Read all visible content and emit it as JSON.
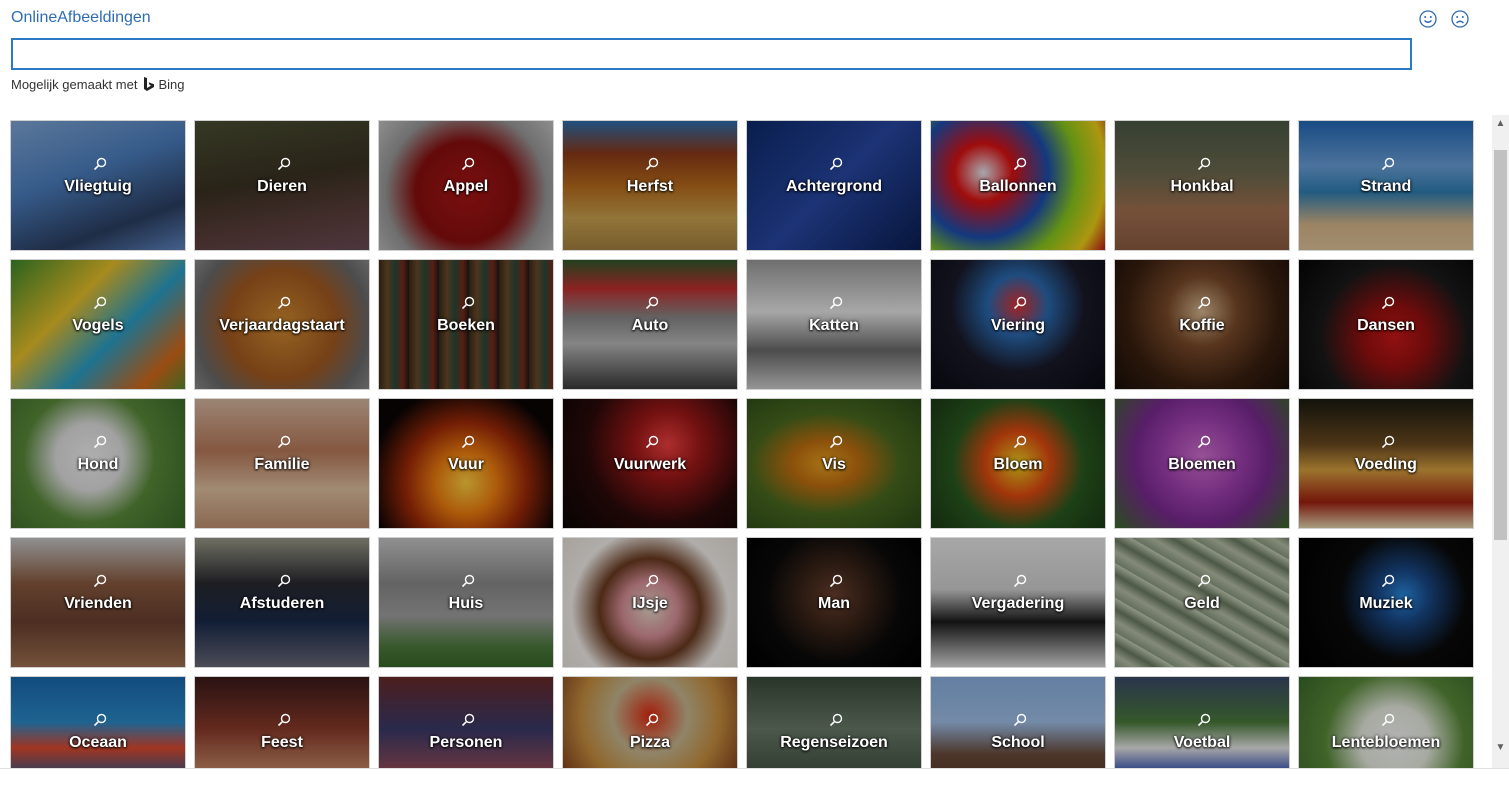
{
  "dialog": {
    "title": "OnlineAfbeeldingen",
    "search": {
      "value": "",
      "placeholder": ""
    },
    "powered_by": "Mogelijk gemaakt met",
    "bing_label": "Bing",
    "feedback": {
      "smile_icon": "smile-icon",
      "frown_icon": "frown-icon"
    }
  },
  "colors": {
    "accent": "#2b78c5",
    "title": "#2e6db4"
  },
  "categories": [
    {
      "label": "Vliegtuig",
      "bg": "linear-gradient(160deg,#7fa6d6 0%,#4c7fc0 40%,#2b3f62 75%,#5d86c2 100%)"
    },
    {
      "label": "Dieren",
      "bg": "linear-gradient(170deg,#4a4f33 0%,#3a3222 45%,#5c3f3c 75%,#6b4d57 100%)"
    },
    {
      "label": "Appel",
      "bg": "radial-gradient(circle at 50% 55%,#a91515 0%,#8a0f0f 45%,#9a9a9a 72%,#c4c4c4 100%)"
    },
    {
      "label": "Herfst",
      "bg": "linear-gradient(180deg,#2d6fb0 0%,#8b3a1a 25%,#b86b1b 50%,#c9a24f 75%,#a68240 100%)"
    },
    {
      "label": "Achtergrond",
      "bg": "linear-gradient(135deg,#0d2a6b 0%,#2747a3 50%,#0b1f54 100%)"
    },
    {
      "label": "Ballonnen",
      "bg": "radial-gradient(circle at 30% 40%,#e8e8f0 0%,#d11 20%,#1c4fb0 45%,#8acb1c 65%,#f0d018 85%,#c01818 100%)"
    },
    {
      "label": "Honkbal",
      "bg": "linear-gradient(180deg,#4b5a45 0%,#6d6a50 40%,#a37050 70%,#8a5c40 100%)"
    },
    {
      "label": "Strand",
      "bg": "linear-gradient(180deg,#2469b8 0%,#6aa0d8 35%,#2f7fb3 55%,#d7b78a 80%,#e0c49c 100%)"
    },
    {
      "label": "Vogels",
      "bg": "linear-gradient(135deg,#3c8a2a 0%,#e8c02a 35%,#2aa0c8 60%,#d66a1a 85%,#5a8a30 100%)"
    },
    {
      "label": "Verjaardagstaart",
      "bg": "radial-gradient(circle at 50% 50%,#d08a30 0%,#a45a20 50%,#6a6a6a 80%,#8a8a8a 100%)"
    },
    {
      "label": "Boeken",
      "bg": "repeating-linear-gradient(90deg,#3a2a1a 0px,#6a4a2a 8px,#2a4a3a 16px,#7a2a1a 24px,#1a1a1a 30px)"
    },
    {
      "label": "Auto",
      "bg": "linear-gradient(180deg,#2e5a2a 0%,#c23030 22%,#8a8a8a 45%,#b8b8b8 65%,#3a3a3a 100%)"
    },
    {
      "label": "Katten",
      "bg": "linear-gradient(180deg,#9a9a9a 0%,#e8e8e8 40%,#6a6a6a 70%,#cfcfcf 100%)"
    },
    {
      "label": "Viering",
      "bg": "radial-gradient(circle at 50% 35%,#e03030 0%,#2a6ab0 25%,#1a1a2a 55%,#0a0a14 100%)"
    },
    {
      "label": "Koffie",
      "bg": "radial-gradient(circle at 50% 40%,#d8b890 0%,#7a4a2a 30%,#3a2010 65%,#1a0e08 100%)"
    },
    {
      "label": "Dansen",
      "bg": "radial-gradient(circle at 55% 60%,#c81818 0%,#9a1010 25%,#1a1a1a 60%,#050505 100%)"
    },
    {
      "label": "Hond",
      "bg": "radial-gradient(circle at 45% 45%,#f2f2f2 0%,#e0e0e0 28%,#5a8a3a 55%,#3a6a2a 100%)"
    },
    {
      "label": "Familie",
      "bg": "linear-gradient(180deg,#d8b8a0 0%,#b87a5a 40%,#e0c0a0 70%,#c09070 100%)"
    },
    {
      "label": "Vuur",
      "bg": "radial-gradient(circle at 50% 65%,#ffd040 0%,#f08010 25%,#a02a08 50%,#0a0505 80%)"
    },
    {
      "label": "Vuurwerk",
      "bg": "radial-gradient(circle at 60% 35%,#f04040 0%,#a01818 25%,#2a0a0a 60%,#0a0505 100%)"
    },
    {
      "label": "Vis",
      "bg": "radial-gradient(ellipse at 45% 50%,#e8a020 0%,#c07010 25%,#4a6a20 55%,#2a4a18 100%)"
    },
    {
      "label": "Bloem",
      "bg": "radial-gradient(circle at 50% 50%,#f0d020 0%,#e04a10 30%,#2a5a20 60%,#1a3a14 100%)"
    },
    {
      "label": "Bloemen",
      "bg": "radial-gradient(circle at 50% 45%,#d070d0 0%,#a040b0 35%,#7a2a90 60%,#3a6a2a 100%)"
    },
    {
      "label": "Voeding",
      "bg": "linear-gradient(180deg,#1a1a10 0%,#6a4a20 35%,#d8a040 55%,#a02010 80%,#e8d8b0 100%)"
    },
    {
      "label": "Vrienden",
      "bg": "linear-gradient(180deg,#c8c8c8 0%,#8a5a40 35%,#6a4030 65%,#a07050 100%)"
    },
    {
      "label": "Afstuderen",
      "bg": "linear-gradient(180deg,#9a9a8a 0%,#2a2a30 35%,#1a2a4a 65%,#6a6a7a 100%)"
    },
    {
      "label": "Huis",
      "bg": "linear-gradient(180deg,#c8c8c8 0%,#8a8a8a 35%,#a0a0a0 60%,#4a7a3a 85%,#3a6a2a 100%)"
    },
    {
      "label": "IJsje",
      "bg": "radial-gradient(circle at 50% 55%,#e8d8c8 0%,#d89098 25%,#6a3a20 45%,#f4f0ec 70%,#e8e0d8 100%)"
    },
    {
      "label": "Man",
      "bg": "radial-gradient(circle at 50% 45%,#6a4030 0%,#3a2418 30%,#0a0a0a 60%,#000000 100%)"
    },
    {
      "label": "Vergadering",
      "bg": "linear-gradient(180deg,#e8e8e8 0%,#d0d0d0 40%,#1a1a1a 65%,#e0e0e0 100%)"
    },
    {
      "label": "Geld",
      "bg": "repeating-linear-gradient(30deg,#8a9a80 0px,#b8c0a8 10px,#6a7a60 20px,#c8d0b8 30px)"
    },
    {
      "label": "Muziek",
      "bg": "radial-gradient(circle at 60% 45%,#2a8ae0 0%,#1a4a8a 20%,#0a0a0a 50%,#000000 100%)"
    },
    {
      "label": "Oceaan",
      "bg": "linear-gradient(180deg,#1a6ab0 0%,#2a8ac8 35%,#e04a30 55%,#1a5a90 80%,#0a3a70 100%)"
    },
    {
      "label": "Feest",
      "bg": "linear-gradient(180deg,#3a1a1a 0%,#8a3a2a 40%,#c08060 70%,#5a2a1a 100%)"
    },
    {
      "label": "Personen",
      "bg": "linear-gradient(180deg,#6a2a2a 0%,#3a3a6a 40%,#8a4a5a 70%,#2a2a4a 100%)"
    },
    {
      "label": "Pizza",
      "bg": "radial-gradient(circle at 50% 30%,#e02a10 0%,#c8b890 30%,#c89040 55%,#8a4a20 80%,#6a3a18 100%)"
    },
    {
      "label": "Regenseizoen",
      "bg": "linear-gradient(180deg,#3a4a3a 0%,#6a7a6a 40%,#4a5a4a 70%,#2a3a2a 100%)"
    },
    {
      "label": "School",
      "bg": "linear-gradient(180deg,#8ab0e0 0%,#a0c0e8 35%,#6a4a3a 60%,#5a3a2a 80%,#4a6a3a 100%)"
    },
    {
      "label": "Voetbal",
      "bg": "linear-gradient(180deg,#3a4a6a 0%,#4a7a3a 35%,#e8e8e8 55%,#2a4ab0 75%,#3a6a2a 100%)"
    },
    {
      "label": "Lentebloemen",
      "bg": "radial-gradient(circle at 55% 50%,#f8f8f8 0%,#e8ece0 30%,#5a8a3a 60%,#3a6a2a 100%)"
    }
  ],
  "scrollbar": {
    "up_icon": "chevron-up-icon",
    "down_icon": "chevron-down-icon",
    "position_fraction": 0.0
  }
}
